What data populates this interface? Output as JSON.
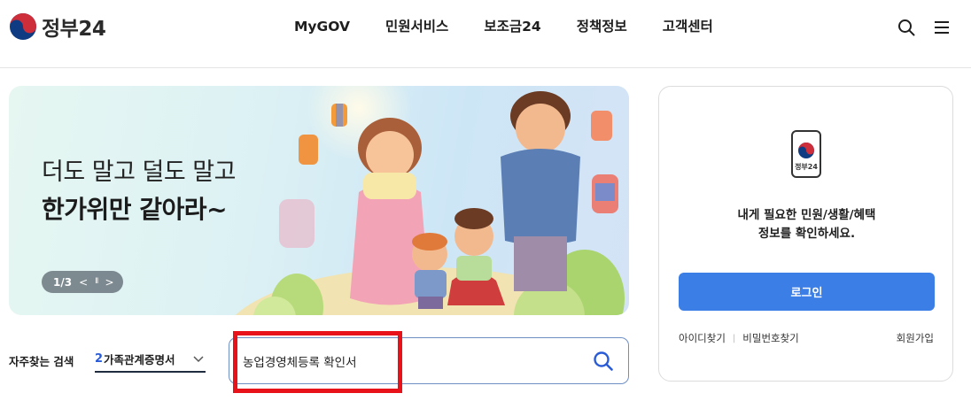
{
  "header": {
    "logo_text": "정부24",
    "nav": [
      "MyGOV",
      "민원서비스",
      "보조금24",
      "정책정보",
      "고객센터"
    ],
    "icons": [
      "search-icon",
      "menu-icon"
    ]
  },
  "banner": {
    "line1": "더도 말고 덜도 말고",
    "line2": "한가위만 같아라~",
    "slide_counter": "1/3",
    "prev_glyph": "<",
    "pause_glyph": "II",
    "next_glyph": ">"
  },
  "search": {
    "frequent_label": "자주찾는 검색",
    "frequent_rank": "2",
    "frequent_term": "가족관계증명서",
    "query": "농업경영체등록 확인서"
  },
  "login": {
    "phone_label": "정부24",
    "message_line1": "내게 필요한 민원/생활/혜택",
    "message_line2": "정보를 확인하세요.",
    "login_button": "로그인",
    "find_id": "아이디찾기",
    "find_password": "비밀번호찾기",
    "join": "회원가입"
  },
  "colors": {
    "accent_blue": "#3a7ee6",
    "highlight_red": "#e8121b",
    "rank_blue": "#2a5bd7",
    "emblem_red": "#cd2e3a",
    "emblem_blue": "#0f3b82"
  }
}
